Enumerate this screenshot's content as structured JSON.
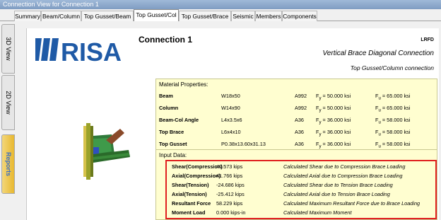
{
  "window": {
    "title": "Connection View for Connection 1"
  },
  "tabs": [
    {
      "label": "Summary"
    },
    {
      "label": "Beam/Column"
    },
    {
      "label": "Top Gusset/Beam"
    },
    {
      "label": "Top Gusset/Col"
    },
    {
      "label": "Top Gusset/Brace"
    },
    {
      "label": "Seismic"
    },
    {
      "label": "Members"
    },
    {
      "label": "Components"
    }
  ],
  "active_tab": "Top Gusset/Col",
  "side_tabs": [
    {
      "label": "3D View"
    },
    {
      "label": "2D View"
    },
    {
      "label": "Reports"
    }
  ],
  "active_side_tab": "Reports",
  "logo": {
    "text": "RISA",
    "icon": "risa-logo-icon",
    "color": "#1f5aa6"
  },
  "report": {
    "title": "Connection 1",
    "code": "LRFD",
    "subtitle": "Vertical Brace Diagonal Connection",
    "subtitle2": "Top Gusset/Column connection"
  },
  "material_properties": {
    "heading": "Material Properties:",
    "rows": [
      {
        "name": "Beam",
        "size": "W18x50",
        "grade": "A992",
        "fy_label": "F",
        "fy_sub": "y",
        "fy_value": "= 50.000 ksi",
        "fu_label": "F",
        "fu_sub": "u",
        "fu_value": "= 65.000 ksi"
      },
      {
        "name": "Column",
        "size": "W14x90",
        "grade": "A992",
        "fy_label": "F",
        "fy_sub": "y",
        "fy_value": "= 50.000 ksi",
        "fu_label": "F",
        "fu_sub": "u",
        "fu_value": "= 65.000 ksi"
      },
      {
        "name": "Beam-Col Angle",
        "size": "L4x3.5x6",
        "grade": "A36",
        "fy_label": "F",
        "fy_sub": "y",
        "fy_value": "= 36.000 ksi",
        "fu_label": "F",
        "fu_sub": "u",
        "fu_value": "= 58.000 ksi"
      },
      {
        "name": "Top Brace",
        "size": "L6x4x10",
        "grade": "A36",
        "fy_label": "F",
        "fy_sub": "y",
        "fy_value": "= 36.000 ksi",
        "fu_label": "F",
        "fu_sub": "u",
        "fu_value": "= 58.000 ksi"
      },
      {
        "name": "Top Gusset",
        "size": "P0.38x13.60x31.13",
        "grade": "A36",
        "fy_label": "F",
        "fy_sub": "y",
        "fy_value": "= 36.000 ksi",
        "fu_label": "F",
        "fu_sub": "u",
        "fu_value": "= 58.000 ksi"
      }
    ]
  },
  "input_data": {
    "heading": "Input Data:",
    "rows": [
      {
        "name": "Shear(Compression)",
        "value": "40.573 kips",
        "description": "Calculated Shear due to Compression Brace Loading"
      },
      {
        "name": "Axial(Compression)",
        "value": "41.766 kips",
        "description": "Calculated Axial due to Compression Brace Loading"
      },
      {
        "name": "Shear(Tension)",
        "value": "-24.686 kips",
        "description": "Calculated Shear due to Tension Brace Loading"
      },
      {
        "name": "Axial(Tension)",
        "value": "-25.412 kips",
        "description": "Calculated Axial due to Tension Brace Loading"
      },
      {
        "name": "Resultant Force",
        "value": "58.229 kips",
        "description": "Calculated Maximum Resultant Force due to Brace Loading"
      },
      {
        "name": "Moment Load",
        "value": "0.000 kips-in",
        "description": "Calculated Maximum Moment"
      }
    ]
  },
  "colors": {
    "highlight_border": "#e02020",
    "table_background": "#fffed0",
    "reports_tab": "#e8b830"
  }
}
